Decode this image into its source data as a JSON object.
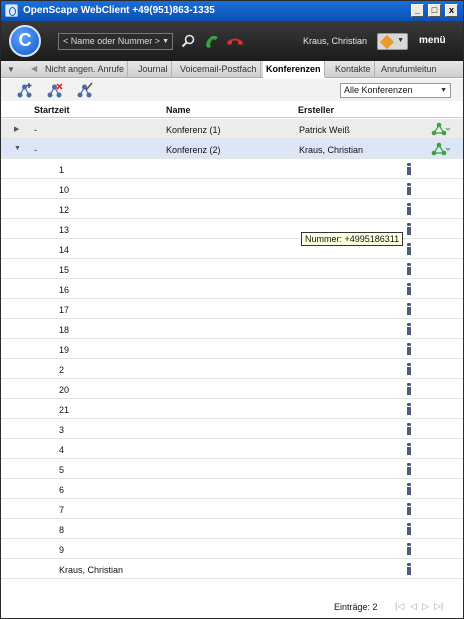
{
  "window": {
    "title": "OpenScape WebClient +49(951)863-1335",
    "minimize_label": "_",
    "maximize_label": "□",
    "close_label": "x"
  },
  "header": {
    "logo_label": "C",
    "number_placeholder": "< Name oder Nummer >",
    "user_name": "Kraus, Christian",
    "menu_label": "menü"
  },
  "tabs": [
    {
      "label": "Nicht angen. Anrufe",
      "active": false
    },
    {
      "label": "Journal",
      "active": false
    },
    {
      "label": "Voicemail-Postfach",
      "active": false
    },
    {
      "label": "Konferenzen",
      "active": true
    },
    {
      "label": "Kontakte",
      "active": false
    },
    {
      "label": "Anrufumleitun",
      "active": false
    }
  ],
  "filter": {
    "selected": "Alle Konferenzen"
  },
  "table": {
    "columns": [
      "Startzeit",
      "Name",
      "Ersteller"
    ],
    "conferences": [
      {
        "start": "-",
        "name": "Konferenz (1)",
        "creator": "Patrick Weiß",
        "expanded": false
      },
      {
        "start": "-",
        "name": "Konferenz (2)",
        "creator": "Kraus, Christian",
        "expanded": true
      }
    ],
    "members": [
      "1",
      "10",
      "12",
      "13",
      "14",
      "15",
      "16",
      "17",
      "18",
      "19",
      "2",
      "20",
      "21",
      "3",
      "4",
      "5",
      "6",
      "7",
      "8",
      "9",
      "Kraus, Christian"
    ]
  },
  "tooltip": {
    "text": "Nummer: +4995186311"
  },
  "footer": {
    "entries_label": "Einträge: 2"
  },
  "colors": {
    "titlebar": "#0a4fb6",
    "header": "#1b1b1b",
    "selected_row": "#dce6f7",
    "conference_icon": "#3aa040",
    "hangup": "#d8302a"
  }
}
